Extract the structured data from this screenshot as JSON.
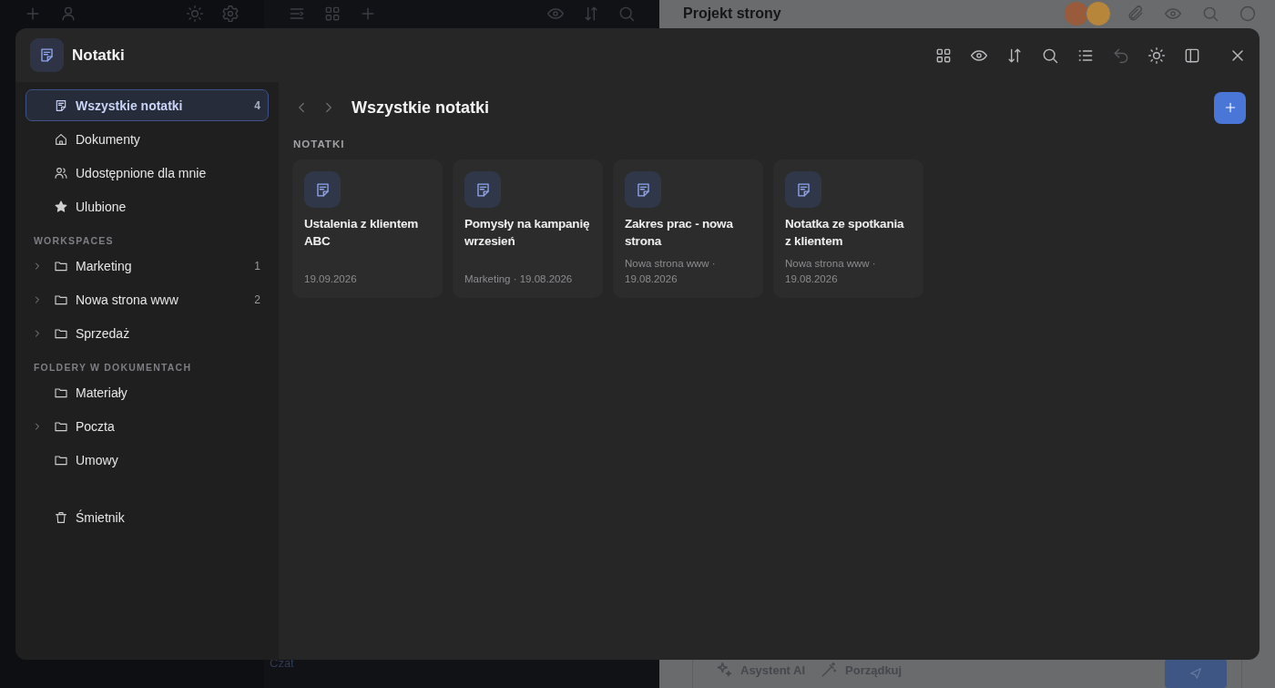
{
  "background": {
    "left_tools": [
      {
        "kind": "plus"
      },
      {
        "kind": "user"
      },
      {
        "kind": "sun"
      },
      {
        "kind": "gear"
      }
    ],
    "middle_tools": [
      {
        "kind": "lines"
      },
      {
        "kind": "grid"
      },
      {
        "kind": "plus"
      }
    ],
    "middle_right_tools": [
      {
        "kind": "eye"
      },
      {
        "kind": "sort"
      },
      {
        "kind": "search"
      }
    ],
    "chat_label": "Czat",
    "title": "Projekt strony",
    "avatars": [
      {
        "color": "#9a5a3c"
      },
      {
        "color": "#b8863a"
      }
    ],
    "right_tools": [
      {
        "kind": "paperclip"
      },
      {
        "kind": "eye"
      },
      {
        "kind": "search"
      },
      {
        "kind": "circle"
      }
    ],
    "composer_tools": [
      {
        "kind": "sparkle",
        "label": "Asystent AI"
      },
      {
        "kind": "wand",
        "label": "Porządkuj"
      }
    ]
  },
  "modal": {
    "title": "Notatki",
    "toolbar": [
      {
        "kind": "grid",
        "disabled": false
      },
      {
        "kind": "eye",
        "disabled": false
      },
      {
        "kind": "sort",
        "disabled": false
      },
      {
        "kind": "search",
        "disabled": false
      },
      {
        "kind": "list",
        "disabled": false
      },
      {
        "kind": "undo",
        "disabled": true
      },
      {
        "kind": "sun",
        "disabled": false
      },
      {
        "kind": "panel",
        "disabled": false
      }
    ],
    "sidebar": {
      "sections": [
        {
          "items": [
            {
              "kind": "note",
              "label": "Wszystkie notatki",
              "count": "4",
              "selected": true,
              "expandable": false
            },
            {
              "kind": "home",
              "label": "Dokumenty",
              "selected": false,
              "expandable": false
            },
            {
              "kind": "users",
              "label": "Udostępnione dla mnie",
              "selected": false,
              "expandable": false
            },
            {
              "kind": "star",
              "label": "Ulubione",
              "selected": false,
              "expandable": false
            }
          ]
        },
        {
          "heading": "WORKSPACES",
          "items": [
            {
              "kind": "folder",
              "label": "Marketing",
              "count": "1",
              "selected": false,
              "expandable": true
            },
            {
              "kind": "folder",
              "label": "Nowa strona www",
              "count": "2",
              "selected": false,
              "expandable": true
            },
            {
              "kind": "folder",
              "label": "Sprzedaż",
              "selected": false,
              "expandable": true
            }
          ]
        },
        {
          "heading": "FOLDERY W DOKUMENTACH",
          "items": [
            {
              "kind": "folder",
              "label": "Materiały",
              "selected": false,
              "expandable": false
            },
            {
              "kind": "folder",
              "label": "Poczta",
              "selected": false,
              "expandable": true
            },
            {
              "kind": "folder",
              "label": "Umowy",
              "selected": false,
              "expandable": false
            }
          ]
        }
      ],
      "trash": {
        "kind": "trash",
        "label": "Śmietnik",
        "selected": false
      }
    },
    "main": {
      "title": "Wszystkie notatki",
      "section_label": "NOTATKI",
      "notes": [
        {
          "title": "Ustalenia z klientem ABC",
          "meta": "19.09.2026"
        },
        {
          "title": "Pomysły na kampanię wrzesień",
          "meta": "Marketing · 19.08.2026"
        },
        {
          "title": "Zakres prac - nowa strona",
          "meta": "Nowa strona www · 19.08.2026"
        },
        {
          "title": "Notatka ze spotkania z klientem",
          "meta": "Nowa strona www · 19.08.2026"
        }
      ]
    }
  }
}
